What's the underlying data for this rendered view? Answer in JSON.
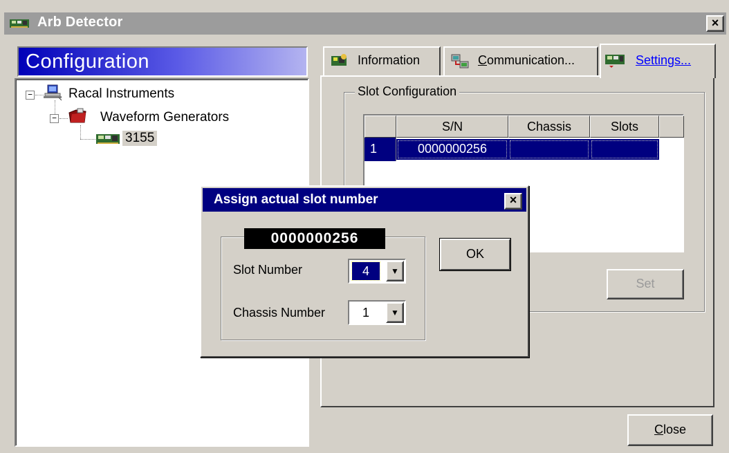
{
  "window": {
    "title": "Arb Detector",
    "close_glyph": "×",
    "icon": "arb-card-icon"
  },
  "config": {
    "title": "Configuration"
  },
  "tree": {
    "root": {
      "label": "Racal Instruments",
      "expander": "−",
      "icon": "computer-icon"
    },
    "group": {
      "label": "Waveform Generators",
      "expander": "−",
      "icon": "folder-icon"
    },
    "leaf": {
      "label": "3155",
      "icon": "arb-card-icon"
    }
  },
  "tabs": [
    {
      "label": "Information",
      "icon": "info-icon"
    },
    {
      "label_pre": "",
      "label_u": "C",
      "label_post": "ommunication...",
      "icon": "communication-icon"
    },
    {
      "label": "Settings...",
      "icon": "settings-icon",
      "active": true
    }
  ],
  "slot_config": {
    "title": "Slot Configuration",
    "columns": [
      "S/N",
      "Chassis",
      "Slots"
    ],
    "rows": [
      {
        "num": "1",
        "sn": "0000000256",
        "chassis": "",
        "slots": ""
      }
    ],
    "set_label": "Set"
  },
  "close_button": {
    "u": "C",
    "rest": "lose"
  },
  "dialog": {
    "title": "Assign actual slot number",
    "close_glyph": "×",
    "serial": "0000000256",
    "slot_label": "Slot Number",
    "slot_value": "4",
    "chassis_label": "Chassis Number",
    "chassis_value": "1",
    "ok_label": "OK",
    "dropdown_glyph": "▼"
  },
  "colors": {
    "title_active": "#000080",
    "title_inactive": "#9c9c9c",
    "face": "#d4d0c8",
    "link": "#0000ff"
  }
}
